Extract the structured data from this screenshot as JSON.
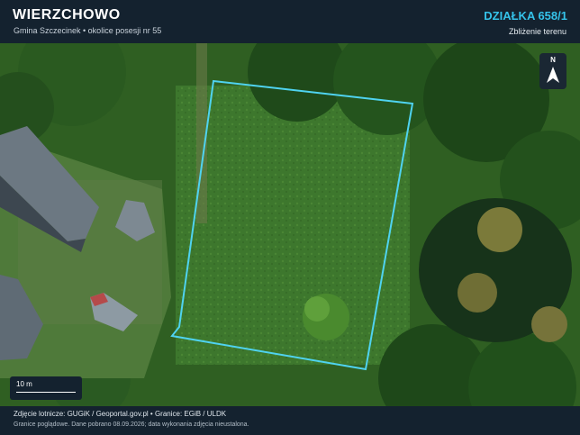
{
  "header": {
    "title": "WIERZCHOWO",
    "subtitle": "Gmina Szczecinek • okolice posesji nr 55",
    "parcel_id": "DZIAŁKA 658/1",
    "view_mode": "Zbliżenie terenu"
  },
  "map": {
    "north_label": "N",
    "scale_label": "10 m",
    "parcel_outline_color": "#4fd3f0"
  },
  "footer": {
    "credits": "Zdjęcie lotnicze: GUGiK / Geoportal.gov.pl • Granice: EGiB / ULDK",
    "disclaimer": "Granice poglądowe. Dane pobrano 08.09.2026; data wykonania zdjęcia nieustalona."
  }
}
